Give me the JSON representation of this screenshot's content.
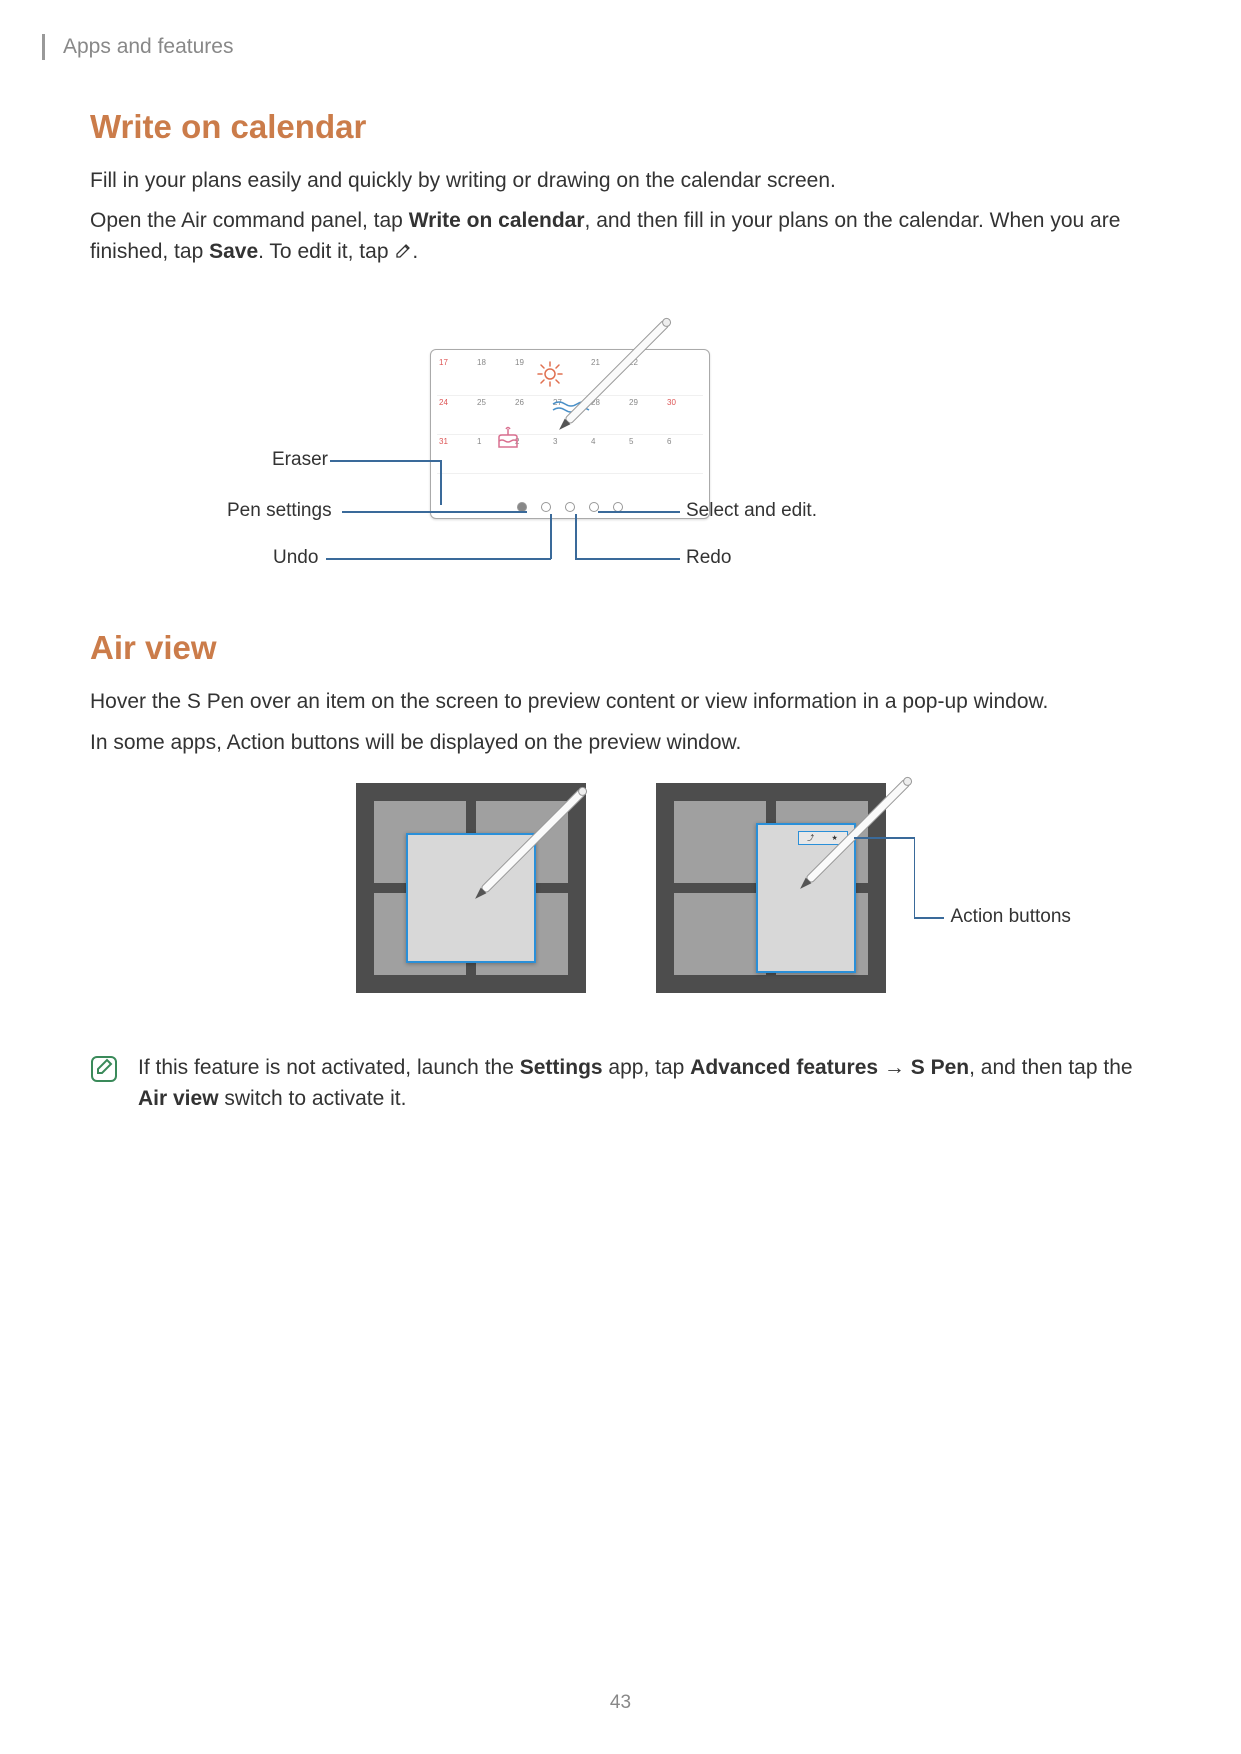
{
  "header": {
    "section": "Apps and features"
  },
  "section1": {
    "title": "Write on calendar",
    "p1": "Fill in your plans easily and quickly by writing or drawing on the calendar screen.",
    "p2a": "Open the Air command panel, tap ",
    "p2b": "Write on calendar",
    "p2c": ", and then fill in your plans on the calendar. When you are finished, tap ",
    "p2d": "Save",
    "p2e": ". To edit it, tap ",
    "p2f": "."
  },
  "callouts1": {
    "eraser": "Eraser",
    "pen_settings": "Pen settings",
    "undo": "Undo",
    "select_edit": "Select and edit.",
    "redo": "Redo"
  },
  "calendar_dates": {
    "row1": [
      "17",
      "18",
      "19",
      "",
      "21",
      "22",
      ""
    ],
    "row2": [
      "24",
      "25",
      "26",
      "27",
      "28",
      "29",
      "30"
    ],
    "row3": [
      "31",
      "1",
      "2",
      "3",
      "4",
      "5",
      "6"
    ]
  },
  "section2": {
    "title": "Air view",
    "p1": "Hover the S Pen over an item on the screen to preview content or view information in a pop-up window.",
    "p2": "In some apps, Action buttons will be displayed on the preview window."
  },
  "callouts2": {
    "action_buttons": "Action buttons"
  },
  "note": {
    "t1": "If this feature is not activated, launch the ",
    "t2": "Settings",
    "t3": " app, tap ",
    "t4": "Advanced features",
    "t5": " → ",
    "t6": "S Pen",
    "t7": ", and then tap the ",
    "t8": "Air view",
    "t9": " switch to activate it."
  },
  "page_number": "43"
}
